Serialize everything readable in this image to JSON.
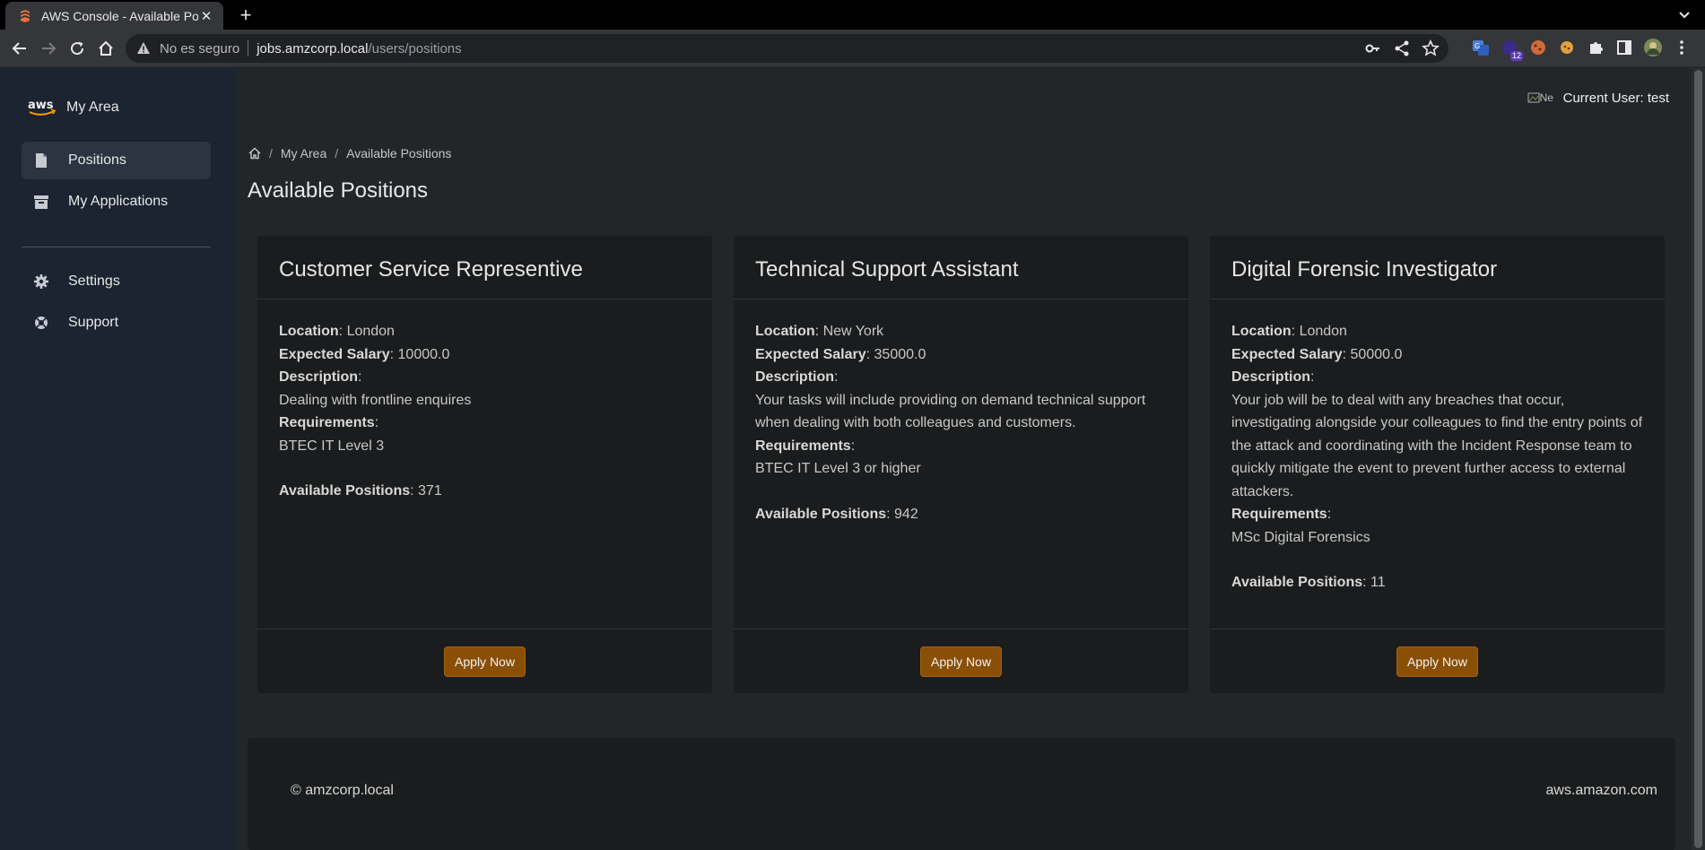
{
  "browser": {
    "tab_title": "AWS Console - Available Positions",
    "omnibox": {
      "security_label": "No es seguro",
      "host": "jobs.amzcorp.local",
      "path": "/users/positions"
    },
    "extension_badge": "12"
  },
  "sidebar": {
    "brand_title": "My Area",
    "items": [
      {
        "label": "Positions",
        "icon": "file-icon",
        "active": true
      },
      {
        "label": "My Applications",
        "icon": "archive-icon",
        "active": false
      },
      {
        "label": "Settings",
        "icon": "gear-icon",
        "active": false
      },
      {
        "label": "Support",
        "icon": "lifebuoy-icon",
        "active": false
      }
    ]
  },
  "header": {
    "avatar_alt": "Ne",
    "current_user": "Current User: test"
  },
  "breadcrumb": {
    "items": [
      "My Area",
      "Available Positions"
    ]
  },
  "page_title": "Available Positions",
  "labels": {
    "location": "Location",
    "salary": "Expected Salary",
    "description": "Description",
    "requirements": "Requirements",
    "positions": "Available Positions",
    "apply": "Apply Now"
  },
  "positions": [
    {
      "title": "Customer Service Representive",
      "location": ": London",
      "salary": ": 10000.0",
      "description": "Dealing with frontline enquires",
      "requirements": "BTEC IT Level 3",
      "available": ": 371"
    },
    {
      "title": "Technical Support Assistant",
      "location": ": New York",
      "salary": ": 35000.0",
      "description": "Your tasks will include providing on demand technical support when dealing with both colleagues and customers.",
      "requirements": "BTEC IT Level 3 or higher",
      "available": ": 942"
    },
    {
      "title": "Digital Forensic Investigator",
      "location": ": London",
      "salary": ": 50000.0",
      "description": "Your job will be to deal with any breaches that occur, investigating alongside your colleagues to find the entry points of the attack and coordinating with the Incident Response team to quickly mitigate the event to prevent further access to external attackers.",
      "requirements": "MSc Digital Forensics",
      "available": ": 11"
    }
  ],
  "footer": {
    "left": "© amzcorp.local",
    "right": "aws.amazon.com"
  },
  "colors": {
    "sidebar_bg": "#1b2430",
    "main_bg": "#222628",
    "card_bg": "#1b1c1d",
    "accent_button": "#8a4f06"
  }
}
